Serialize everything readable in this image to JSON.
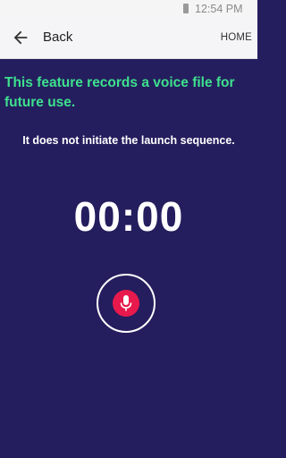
{
  "status_bar": {
    "time": "12:54 PM",
    "icons": [
      "battery-icon"
    ]
  },
  "app_bar": {
    "back_label": "Back",
    "home_label": "HOME",
    "icons": [
      "arrow-left-icon"
    ]
  },
  "content": {
    "headline": "This feature records a voice file for future use.",
    "subline": "It does not initiate the launch sequence.",
    "timer": "00:00"
  },
  "record": {
    "icon": "microphone-icon"
  },
  "colors": {
    "background": "#241e5e",
    "headline": "#3ee08e",
    "record_button": "#e8194c"
  }
}
